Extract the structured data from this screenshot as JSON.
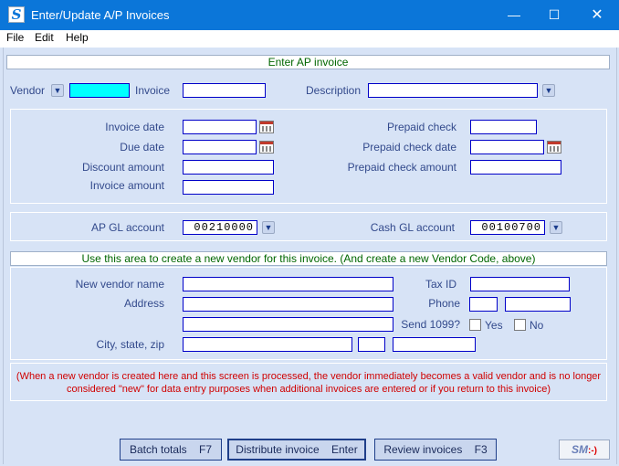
{
  "window": {
    "title": "Enter/Update A/P Invoices",
    "app_icon": "S",
    "minimize": "—",
    "maximize": "☐",
    "close": "✕"
  },
  "menu": {
    "file": "File",
    "edit": "Edit",
    "help": "Help"
  },
  "header": {
    "title": "Enter AP invoice"
  },
  "top_row": {
    "vendor_label": "Vendor",
    "vendor_value": "",
    "invoice_label": "Invoice",
    "invoice_value": "",
    "description_label": "Description",
    "description_value": ""
  },
  "dates": {
    "invoice_date_label": "Invoice date",
    "invoice_date_value": "",
    "due_date_label": "Due date",
    "due_date_value": "",
    "discount_amount_label": "Discount amount",
    "discount_amount_value": "",
    "invoice_amount_label": "Invoice amount",
    "invoice_amount_value": "",
    "prepaid_check_label": "Prepaid check",
    "prepaid_check_value": "",
    "prepaid_check_date_label": "Prepaid check date",
    "prepaid_check_date_value": "",
    "prepaid_check_amount_label": "Prepaid check amount",
    "prepaid_check_amount_value": ""
  },
  "gl": {
    "ap_gl_label": "AP GL account",
    "ap_gl_value": "00210000",
    "cash_gl_label": "Cash GL account",
    "cash_gl_value": "00100700"
  },
  "new_vendor": {
    "header": "Use this area to create a new vendor for this invoice. (And create a new Vendor Code, above)",
    "name_label": "New vendor name",
    "name_value": "",
    "address_label": "Address",
    "address1_value": "",
    "address2_value": "",
    "city_label": "City, state, zip",
    "city_value": "",
    "state_value": "",
    "zip_value": "",
    "tax_id_label": "Tax ID",
    "tax_id_value": "",
    "phone_label": "Phone",
    "phone_area_value": "",
    "phone_number_value": "",
    "send1099_label": "Send 1099?",
    "yes_label": "Yes",
    "no_label": "No"
  },
  "note": {
    "line1": "(When a new vendor is created here and this screen is processed, the vendor immediately becomes a valid vendor and is no longer",
    "line2": "considered \"new\" for data entry purposes when additional invoices are entered or if you return to this invoice)"
  },
  "buttons": {
    "batch_totals": "Batch totals    F7",
    "distribute_invoice": "Distribute invoice    Enter",
    "review_invoices": "Review invoices    F3"
  },
  "logo": {
    "text": "SM",
    "suffix": ":-)"
  },
  "colors": {
    "titlebar": "#0b76d9",
    "panel": "#d7e3f6",
    "label": "#334a8c",
    "header_text": "#006600",
    "note_text": "#d00000",
    "vendor_field": "#00ffff"
  }
}
